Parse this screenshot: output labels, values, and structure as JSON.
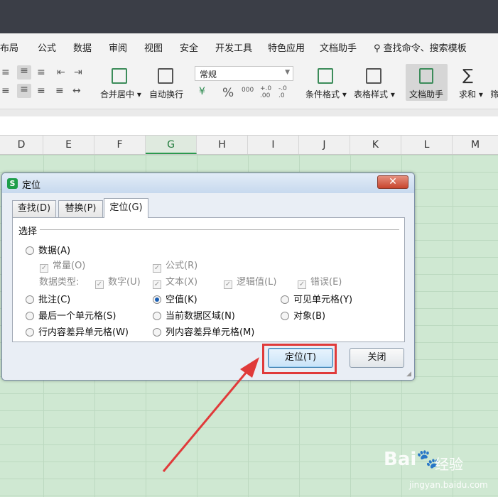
{
  "menu": [
    "布局",
    "公式",
    "数据",
    "审阅",
    "视图",
    "安全",
    "开发工具",
    "特色应用",
    "文档助手"
  ],
  "search": {
    "label": "查找命令、搜索模板"
  },
  "ribbon": {
    "merge_center": "合并居中",
    "auto_wrap": "自动换行",
    "number_format": "常规",
    "currency_symbol": "¥",
    "percent_symbol": "%",
    "thousands_symbol": "000",
    "inc_decimal": "+.0 .00",
    "dec_decimal": "-.0 .0",
    "conditional_format": "条件格式",
    "table_style": "表格样式",
    "doc_helper": "文档助手",
    "sum": "求和",
    "filter_partial": "筛"
  },
  "columns": [
    "D",
    "E",
    "F",
    "G",
    "H",
    "I",
    "J",
    "K",
    "L",
    "M"
  ],
  "selected_column": "G",
  "dialog": {
    "title": "定位",
    "close_symbol": "✕",
    "tabs": [
      "查找(D)",
      "替换(P)",
      "定位(G)"
    ],
    "active_tab": "定位(G)",
    "group_label": "选择",
    "options": {
      "data": "数据(A)",
      "constant": "常量(O)",
      "formula": "公式(R)",
      "data_type_label": "数据类型:",
      "number": "数字(U)",
      "text": "文本(X)",
      "logical": "逻辑值(L)",
      "error": "错误(E)",
      "comment": "批注(C)",
      "blank": "空值(K)",
      "visible_cells": "可见单元格(Y)",
      "last_cell": "最后一个单元格(S)",
      "current_region": "当前数据区域(N)",
      "objects": "对象(B)",
      "row_diff": "行内容差异单元格(W)",
      "col_diff": "列内容差异单元格(M)"
    },
    "selected_option": "空值(K)",
    "locate_button": "定位(T)",
    "close_button": "关闭"
  },
  "watermark": {
    "logo": "Bai🐾",
    "cn": "经验",
    "url": "jingyan.baidu.com"
  },
  "colors": {
    "arrow": "#e03a3a",
    "grid": "#cfe8d2",
    "accent": "#1e9e4a"
  }
}
